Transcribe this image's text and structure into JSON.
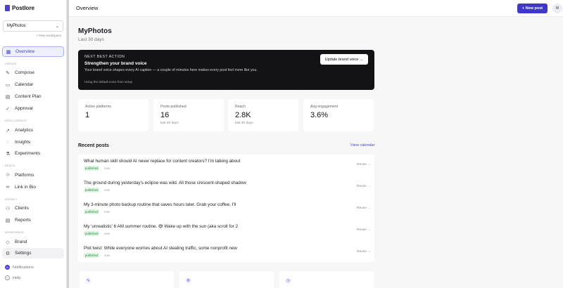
{
  "app": {
    "name": "Postlore"
  },
  "workspace": {
    "selected": "MyPhotos",
    "new_label": "+ New workspace"
  },
  "sidebar": {
    "sections": [
      "CREATE",
      "INTELLIGENCE",
      "REACH",
      "AGENCY",
      "WORKSPACE"
    ],
    "items": [
      {
        "label": "Overview",
        "icon": "grid-icon"
      },
      {
        "label": "Compose",
        "icon": "pen-icon"
      },
      {
        "label": "Calendar",
        "icon": "calendar-icon"
      },
      {
        "label": "Content Plan",
        "icon": "document-icon"
      },
      {
        "label": "Approval",
        "icon": "check-icon"
      },
      {
        "label": "Analytics",
        "icon": "trend-icon"
      },
      {
        "label": "Insights",
        "icon": "lightbulb-icon"
      },
      {
        "label": "Experiments",
        "icon": "flask-icon"
      },
      {
        "label": "Platforms",
        "icon": "share-icon"
      },
      {
        "label": "Link in Bio",
        "icon": "link-icon"
      },
      {
        "label": "Clients",
        "icon": "users-icon"
      },
      {
        "label": "Reports",
        "icon": "report-icon"
      },
      {
        "label": "Brand",
        "icon": "brand-icon"
      },
      {
        "label": "Settings",
        "icon": "gear-icon"
      }
    ],
    "footer": {
      "notifications": "Notifications",
      "notifications_badge": "N",
      "help": "Help",
      "help_icon_glyph": "?"
    }
  },
  "topbar": {
    "title": "Overview",
    "new_post": "+ New post",
    "avatar": "M"
  },
  "page": {
    "title": "MyPhotos",
    "subtitle": "Last 30 days"
  },
  "next_action": {
    "label": "NEXT BEST ACTION",
    "title": "Strengthen your brand voice",
    "description": "Your brand voice shapes every AI caption — a couple of minutes here makes every post feel more like you.",
    "note": "Using the default voice from setup",
    "button": "Update brand voice →"
  },
  "stats": [
    {
      "label": "Active platforms",
      "value": "1",
      "sub": ""
    },
    {
      "label": "Posts published",
      "value": "16",
      "sub": "last 30 days"
    },
    {
      "label": "Reach",
      "value": "2.8K",
      "sub": "last 30 days"
    },
    {
      "label": "Avg engagement",
      "value": "3.6%",
      "sub": ""
    }
  ],
  "recent": {
    "title": "Recent posts",
    "view_calendar": "View calendar",
    "posts": [
      {
        "text": "What human skill should AI never replace for content creators? I'm talking about",
        "status": "published",
        "time": "now",
        "action": "Reuse →"
      },
      {
        "text": "The ground during yesterday's eclipse was wild. All those crescent-shaped shadow",
        "status": "published",
        "time": "now",
        "action": "Reuse →"
      },
      {
        "text": "My 3-minute photo backup routine that saves hours later. Grab your coffee, I'll",
        "status": "published",
        "time": "now",
        "action": "Reuse →"
      },
      {
        "text": "My 'unrealistic' 6 AM summer routine. 😅 Wake up with the sun (aka scroll for 2",
        "status": "published",
        "time": "now",
        "action": "Reuse →"
      },
      {
        "text": "Plot twist: While everyone worries about AI stealing traffic, some nonprofit new",
        "status": "published",
        "time": "now",
        "action": "Reuse →"
      }
    ]
  },
  "bottom_cards": [
    {
      "icon": "pen-icon",
      "glyph": "✎"
    },
    {
      "icon": "gear-icon",
      "glyph": "⚙"
    },
    {
      "icon": "clock-icon",
      "glyph": "◷"
    }
  ],
  "colors": {
    "accent": "#3e37c9",
    "dark_card": "#131316",
    "badge_bg": "#dff5e4",
    "badge_text": "#2e8a42"
  }
}
